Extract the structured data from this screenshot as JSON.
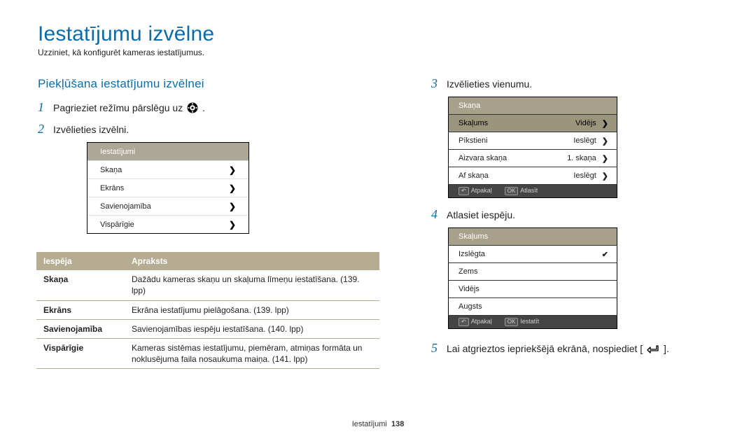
{
  "title": "Iestatījumu izvēlne",
  "intro": "Uzziniet, kā konfigurēt kameras iestatījumus.",
  "subtitle": "Piekļūšana iestatījumu izvēlnei",
  "steps": {
    "s1a": "Pagrieziet režīmu pārslēgu uz ",
    "s1b": ".",
    "s2": "Izvēlieties izvēlni.",
    "s3": "Izvēlieties vienumu.",
    "s4": "Atlasiet iespēju.",
    "s5a": "Lai atgrieztos iepriekšējā ekrānā, nospiediet [",
    "s5b": "]."
  },
  "menu1": {
    "header": "Iestatījumi",
    "items": [
      "Skaņa",
      "Ekrāns",
      "Savienojamība",
      "Vispārīgie"
    ]
  },
  "table": {
    "head": {
      "c1": "Iespēja",
      "c2": "Apraksts"
    },
    "rows": [
      {
        "k": "Skaņa",
        "v": "Dažādu kameras skaņu un skaļuma līmeņu iestatīšana. (139. lpp)"
      },
      {
        "k": "Ekrāns",
        "v": "Ekrāna iestatījumu pielāgošana. (139. lpp)"
      },
      {
        "k": "Savienojamība",
        "v": "Savienojamības iespēju iestatīšana. (140. lpp)"
      },
      {
        "k": "Vispārīgie",
        "v": "Kameras sistēmas iestatījumu, piemēram, atmiņas formāta un noklusējuma faila nosaukuma maiņa. (141. lpp)"
      }
    ]
  },
  "panelA": {
    "header": "Skaņa",
    "rows": [
      {
        "label": "Skaļums",
        "value": "Vidējs",
        "highlight": true
      },
      {
        "label": "Pīkstieni",
        "value": "Ieslēgt"
      },
      {
        "label": "Aizvara skaņa",
        "value": "1. skaņa"
      },
      {
        "label": "Af skaņa",
        "value": "Ieslēgt"
      }
    ],
    "bottom": {
      "back": "Atpakaļ",
      "ok": "OK",
      "okLabel": "Atlasīt"
    }
  },
  "panelB": {
    "header": "Skaļums",
    "rows": [
      "Izslēgta",
      "Zems",
      "Vidējs",
      "Augsts"
    ],
    "checkedIndex": 0,
    "bottom": {
      "back": "Atpakaļ",
      "ok": "OK",
      "okLabel": "Iestatīt"
    }
  },
  "footer": {
    "section": "Iestatījumi",
    "page": "138"
  }
}
